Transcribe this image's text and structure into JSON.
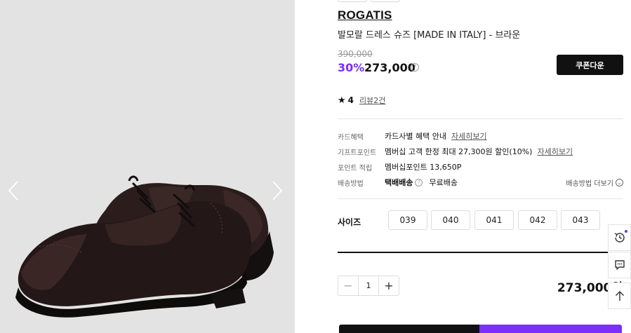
{
  "gallery": {
    "image": "brown-oxford-dress-shoes",
    "prev_icon": "chevron-left-icon",
    "next_icon": "chevron-right-icon"
  },
  "product": {
    "brand": "ROGATIS",
    "name": "발모랄 드레스 슈즈 [MADE IN ITALY] - 브라운",
    "original_price": "390,000",
    "discount": "30%",
    "price": "273,000",
    "price_info_icon": "question-circle-icon",
    "coupon_button": "쿠폰다운"
  },
  "rating": {
    "star_icon": "star-icon",
    "score": "4",
    "reviews": "리뷰2건"
  },
  "benefits": [
    {
      "label": "카드혜택",
      "value": "카드사별 혜택 안내",
      "link": "자세히보기"
    },
    {
      "label": "기프트포인트",
      "value": "멤버십 고객 한정 최대 27,300원 할인(10%)",
      "link": "자세히보기"
    },
    {
      "label": "포인트 적립",
      "value": "멤버십포인트 13,650P",
      "link": ""
    },
    {
      "label": "배송방법",
      "value": "택배배송",
      "extra": "무료배송",
      "link": ""
    }
  ],
  "shipping_more": "배송방법 더보기",
  "size": {
    "label": "사이즈",
    "options": [
      "039",
      "040",
      "041",
      "042",
      "043"
    ]
  },
  "quantity": {
    "minus": "−",
    "value": "1",
    "plus": "+"
  },
  "total_price": "273,000원",
  "colors": {
    "accent": "#7b2ff7",
    "dark": "#111111",
    "gallery_bg": "#e3e3e3"
  },
  "floating": {
    "recent_icon": "history-icon",
    "chat_icon": "chat-icon",
    "top_icon": "arrow-up-icon"
  }
}
